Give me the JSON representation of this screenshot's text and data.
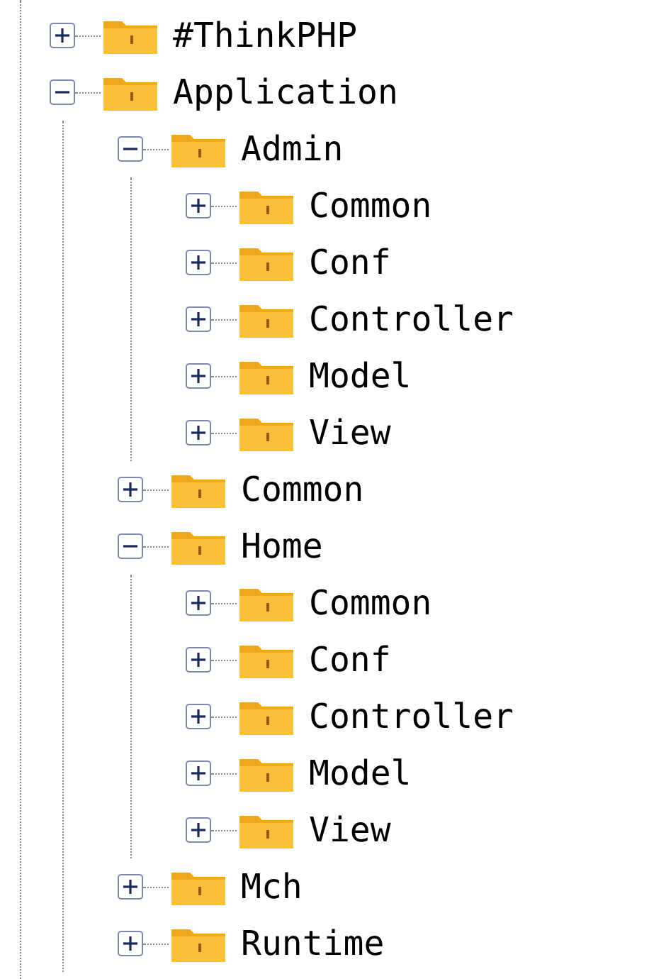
{
  "tree": [
    {
      "label": "#ThinkPHP",
      "expanded": false
    },
    {
      "label": "Application",
      "expanded": true,
      "children": [
        {
          "label": "Admin",
          "expanded": true,
          "children": [
            {
              "label": "Common",
              "expanded": false
            },
            {
              "label": "Conf",
              "expanded": false
            },
            {
              "label": "Controller",
              "expanded": false
            },
            {
              "label": "Model",
              "expanded": false
            },
            {
              "label": "View",
              "expanded": false
            }
          ]
        },
        {
          "label": "Common",
          "expanded": false
        },
        {
          "label": "Home",
          "expanded": true,
          "children": [
            {
              "label": "Common",
              "expanded": false
            },
            {
              "label": "Conf",
              "expanded": false
            },
            {
              "label": "Controller",
              "expanded": false
            },
            {
              "label": "Model",
              "expanded": false
            },
            {
              "label": "View",
              "expanded": false
            }
          ]
        },
        {
          "label": "Mch",
          "expanded": false
        },
        {
          "label": "Runtime",
          "expanded": false
        }
      ]
    }
  ]
}
